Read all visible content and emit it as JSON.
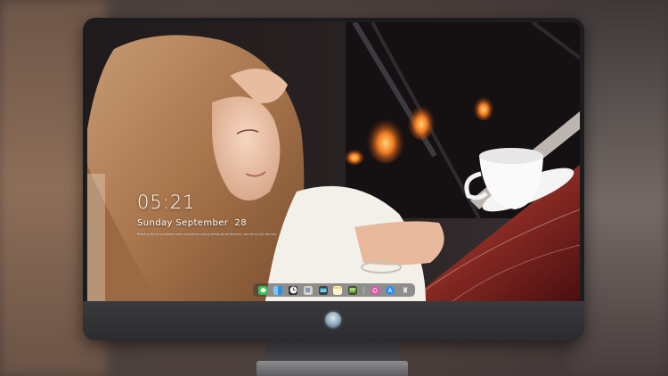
{
  "lock_screen": {
    "time": "05:21",
    "date": "Sunday September  28",
    "quote": "Reading thinking wisdom with a patience young being dares tenacity, sea for by all, the day"
  },
  "dock": {
    "items": [
      {
        "name": "messages-icon",
        "color": "#3ac34b"
      },
      {
        "name": "finder-icon",
        "color": "#2f8ee6"
      },
      {
        "name": "clock-icon",
        "color": "#f2f2f2"
      },
      {
        "name": "preview-icon",
        "color": "#c9c2b0"
      },
      {
        "name": "clips-icon",
        "color": "#6fd0e8"
      },
      {
        "name": "notes-icon",
        "color": "#f6d35a"
      },
      {
        "name": "photos-icon",
        "color": "#7ab648"
      },
      {
        "name": "itunes-icon",
        "color": "#e14fa9"
      },
      {
        "name": "app-store-icon",
        "color": "#2a8ff0"
      },
      {
        "name": "trash-icon",
        "color": "#bfbfc4"
      }
    ]
  },
  "colors": {
    "bezel": "#1c1c1e",
    "chin": "#2f2f32",
    "text": "#ffffff"
  }
}
